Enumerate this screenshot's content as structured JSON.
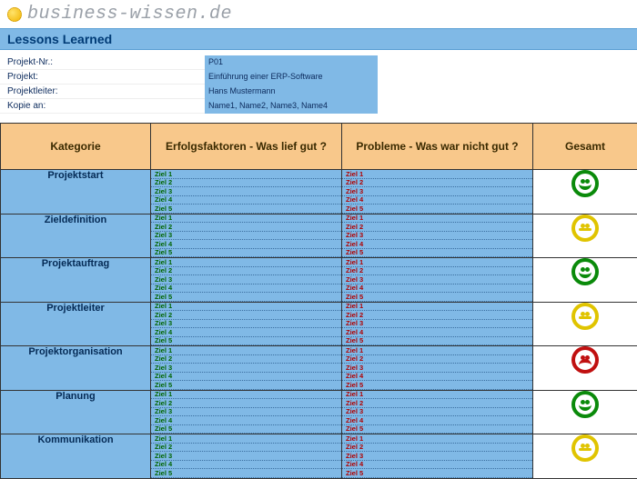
{
  "brand": "business-wissen.de",
  "title": "Lessons Learned",
  "meta": {
    "rows": [
      {
        "label": "Projekt-Nr.:",
        "value": "P01"
      },
      {
        "label": "Projekt:",
        "value": "Einführung einer ERP-Software"
      },
      {
        "label": "Projektleiter:",
        "value": "Hans Mustermann"
      },
      {
        "label": "Kopie an:",
        "value": "Name1, Name2, Name3, Name4"
      }
    ]
  },
  "columns": {
    "category": "Kategorie",
    "good": "Erfolgsfaktoren - Was lief gut ?",
    "bad": "Probleme - Was war nicht gut ?",
    "total": "Gesamt"
  },
  "ziele": [
    "Ziel 1",
    "Ziel 2",
    "Ziel 3",
    "Ziel 4",
    "Ziel 5"
  ],
  "rows": [
    {
      "category": "Projektstart",
      "rating": "green"
    },
    {
      "category": "Zieldefinition",
      "rating": "yellow"
    },
    {
      "category": "Projektauftrag",
      "rating": "green"
    },
    {
      "category": "Projektleiter",
      "rating": "yellow"
    },
    {
      "category": "Projektorganisation",
      "rating": "red"
    },
    {
      "category": "Planung",
      "rating": "green"
    },
    {
      "category": "Kommunikation",
      "rating": "yellow"
    }
  ]
}
